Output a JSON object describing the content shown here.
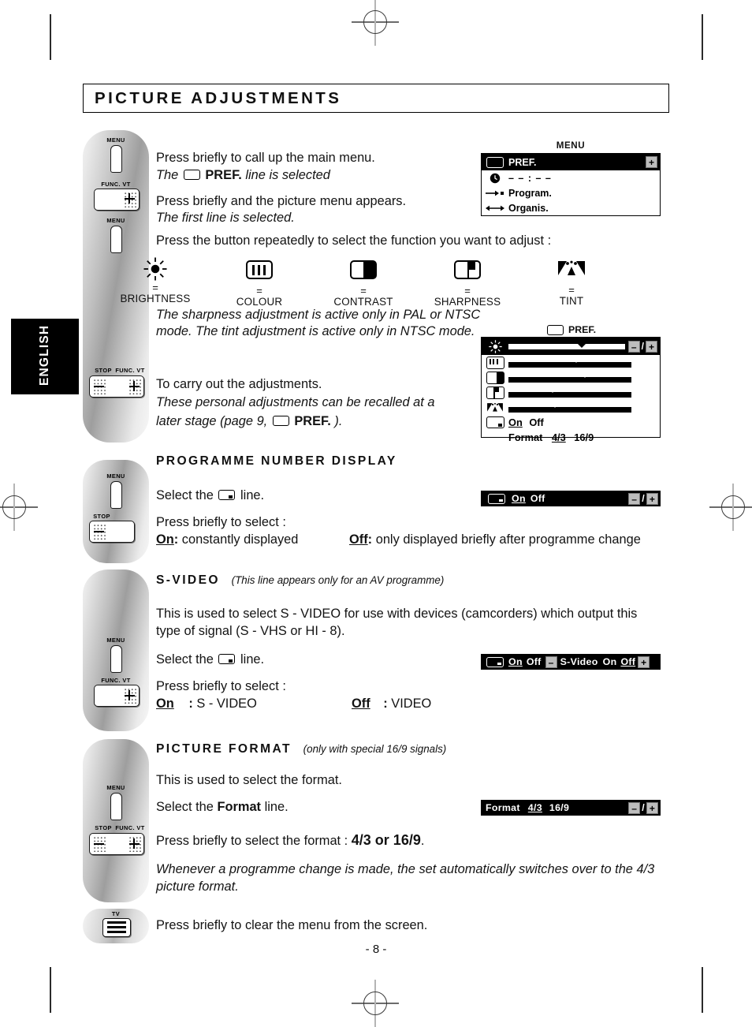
{
  "page": {
    "title": "PICTURE ADJUSTMENTS",
    "language_tab": "ENGLISH",
    "page_number": "- 8 -"
  },
  "remote_labels": {
    "menu": "MENU",
    "func_vt": "FUNC. VT",
    "stop": "STOP",
    "tv": "TV"
  },
  "intro": {
    "line1": "Press briefly to call up the main menu.",
    "line2_pre": "The",
    "line2_bold": "PREF.",
    "line2_post": "line is selected",
    "line3": "Press briefly and the picture menu appears.",
    "line4": "The first line is selected.",
    "line5": "Press the button repeatedly  to select the function you want to adjust :"
  },
  "menu_osd": {
    "caption": "MENU",
    "header_label": "PREF.",
    "plus": "+",
    "rows": [
      {
        "icon": "clock-icon",
        "label": "– – : – –"
      },
      {
        "icon": "arrow-to-dot-icon",
        "label": "Program."
      },
      {
        "icon": "double-arrow-icon",
        "label": "Organis."
      }
    ]
  },
  "adjust_icons": [
    {
      "icon": "sun-icon",
      "eq": "=",
      "label": "BRIGHTNESS"
    },
    {
      "icon": "colour-bars-icon",
      "eq": "=",
      "label": "COLOUR"
    },
    {
      "icon": "contrast-half-icon",
      "eq": "=",
      "label": "CONTRAST"
    },
    {
      "icon": "sharpness-icon",
      "eq": "=",
      "label": "SHARPNESS"
    },
    {
      "icon": "tint-icon",
      "eq": "=",
      "label": "TINT"
    }
  ],
  "notes": {
    "sharpness_note_l1": "The sharpness adjustment is active only in PAL or NTSC",
    "sharpness_note_l2": "mode. The tint adjustment is active only in NTSC mode.",
    "carry_out": "To carry out the adjustments.",
    "recall_l1": "These personal adjustments can be recalled at a",
    "recall_l2_pre": "later stage (page 9,",
    "recall_l2_bold": "PREF.",
    "recall_l2_post": ")."
  },
  "pref_osd": {
    "caption": "PREF.",
    "minus": "–",
    "slash": "/",
    "plus": "+",
    "sliders": [
      {
        "icon": "sun-icon",
        "value": 63
      },
      {
        "icon": "colour-bars-icon",
        "value": 55
      },
      {
        "icon": "contrast-half-icon",
        "value": 62
      },
      {
        "icon": "sharpness-icon",
        "value": 36
      },
      {
        "icon": "tint-icon",
        "value": 38
      }
    ],
    "display_row": {
      "icon": "prog-number-icon",
      "on": "On",
      "off": "Off",
      "selected": "On"
    },
    "format_row": {
      "label": "Format",
      "options": [
        "4/3",
        "16/9"
      ],
      "selected": "4/3"
    }
  },
  "programme_number": {
    "heading": "PROGRAMME NUMBER DISPLAY",
    "select_pre": "Select the",
    "select_post": "line.",
    "press": "Press briefly to select :",
    "on_label": "On",
    "on_colon": ":",
    "on_desc": "constantly displayed",
    "off_label": "Off",
    "off_colon": ":",
    "off_desc": "only displayed briefly after programme change",
    "strip": {
      "on": "On",
      "off": "Off",
      "selected": "On",
      "minus": "–",
      "slash": "/",
      "plus": "+"
    }
  },
  "svideo": {
    "heading": "S-VIDEO",
    "heading_note": "(This line appears only for an AV programme)",
    "body_l1": "This is used to select S - VIDEO for use with devices (camcorders) which output this",
    "body_l2": "type of signal (S - VHS or HI - 8).",
    "select_pre": "Select the",
    "select_post": "line.",
    "press": "Press briefly to select :",
    "on_label": "On",
    "on_colon": ":",
    "on_desc": "S - VIDEO",
    "off_label": "Off",
    "off_colon": ":",
    "off_desc": "VIDEO",
    "strip": {
      "display_on": "On",
      "display_off": "Off",
      "display_selected": "On",
      "minus": "–",
      "svideo_label": "S-Video",
      "sv_on": "On",
      "sv_off": "Off",
      "sv_selected": "Off",
      "plus": "+"
    }
  },
  "picture_format": {
    "heading": "PICTURE FORMAT",
    "heading_note": "(only with special 16/9 signals)",
    "body": "This is used to select the format.",
    "select_pre": "Select the",
    "select_bold": "Format",
    "select_post": "line.",
    "press_pre": "Press briefly to select the format :",
    "press_bold": "4/3 or 16/9",
    "press_post": ".",
    "note_l1": "Whenever a programme change is made, the set automatically switches over to the 4/3",
    "note_l2": "picture format.",
    "strip": {
      "label": "Format",
      "opt1": "4/3",
      "opt2": "16/9",
      "selected": "4/3",
      "minus": "–",
      "slash": "/",
      "plus": "+"
    }
  },
  "clear_menu": {
    "text": "Press briefly to clear the menu from the screen."
  },
  "colors": {
    "ink": "#111111",
    "osd_bg": "#000000",
    "osd_fg": "#ffffff",
    "button_grey": "#bdbdbd"
  }
}
